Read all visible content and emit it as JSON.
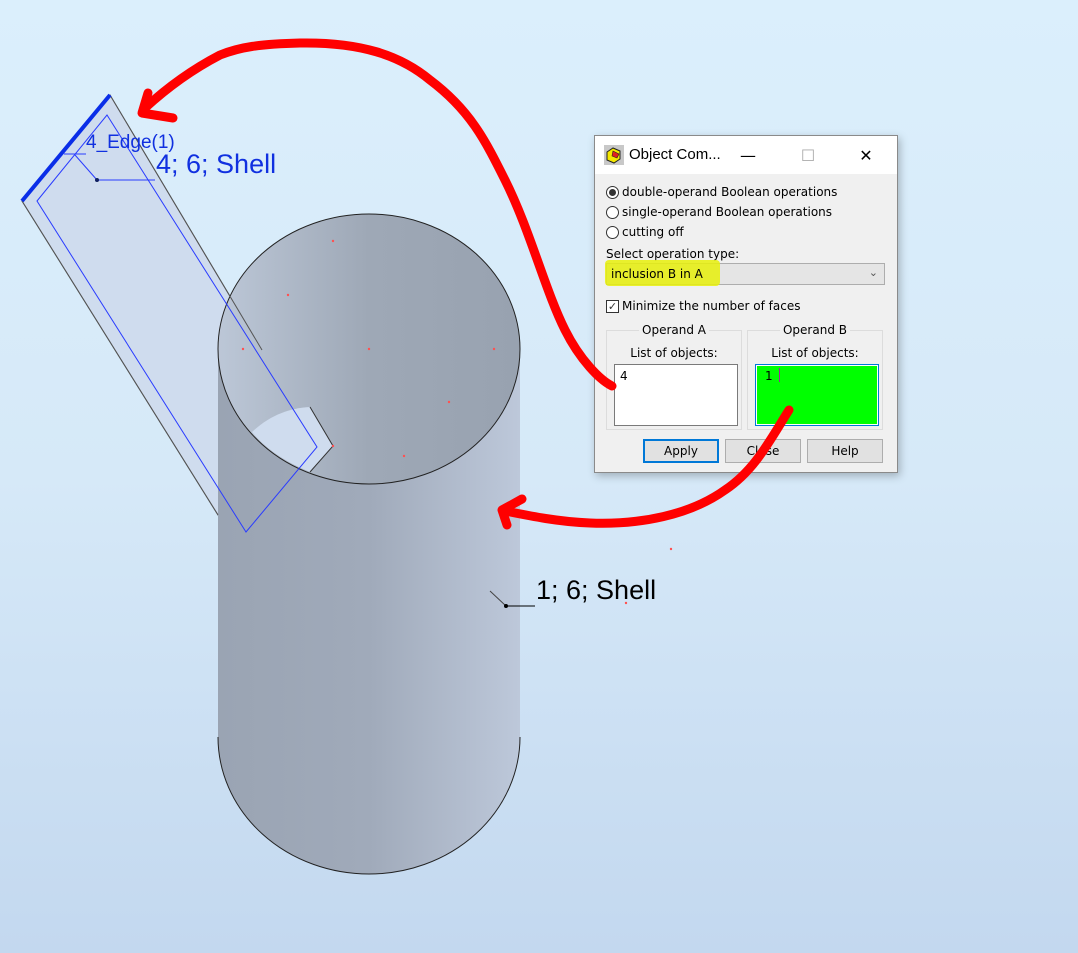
{
  "scene": {
    "shell_plate_label": "4; 6; Shell",
    "edge_label": "4_Edge(1)",
    "cylinder_label": "1; 6; Shell",
    "colors": {
      "background_top": "#dbeffc",
      "background_bottom": "#c3d8ef",
      "cylinder": "#9ea8b6",
      "plate": "#cfdcee",
      "selection_blue": "#1030e0",
      "annotation_red": "#ff0000"
    }
  },
  "dialog": {
    "title": "Object Com...",
    "icon": "object-combination-icon",
    "minimize_glyph": "—",
    "maximize_glyph": "☐",
    "close_glyph": "✕",
    "mode_options": [
      {
        "label": "double-operand Boolean operations",
        "checked": true
      },
      {
        "label": "single-operand Boolean operations",
        "checked": false
      },
      {
        "label": "cutting off",
        "checked": false
      }
    ],
    "operation_type_label": "Select operation type:",
    "operation_type_value": "inclusion B in A",
    "chevron": "⌄",
    "minimize_faces_label": "Minimize the number of faces",
    "minimize_faces_checked": true,
    "check_glyph": "✓",
    "operand_a": {
      "title": "Operand A",
      "list_label": "List of objects:",
      "value": "4"
    },
    "operand_b": {
      "title": "Operand B",
      "list_label": "List of objects:",
      "value": "1"
    },
    "buttons": {
      "apply": "Apply",
      "close": "Close",
      "help": "Help"
    }
  }
}
